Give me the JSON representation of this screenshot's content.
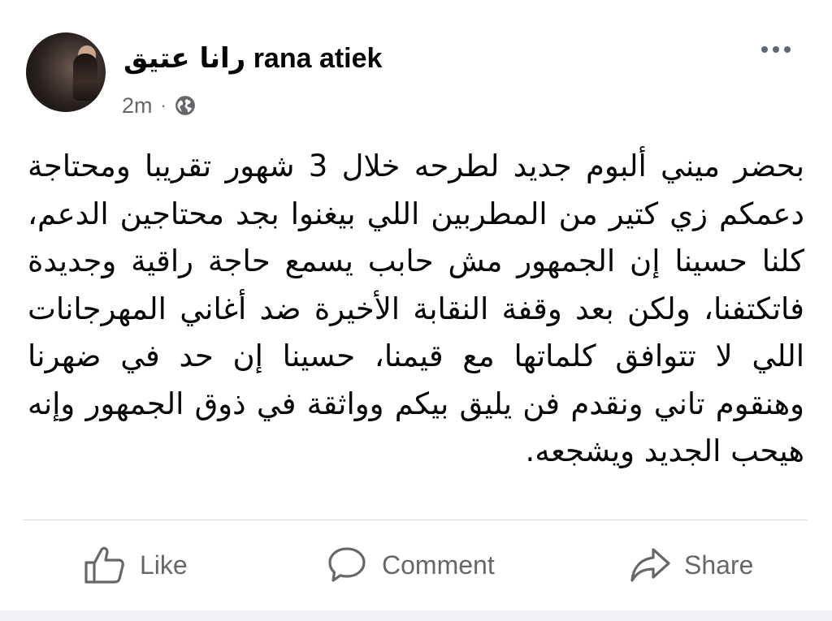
{
  "post": {
    "author_name_ar": "رانا عتيق",
    "author_name_en": "rana atiek",
    "timestamp": "2m",
    "separator": "·",
    "privacy_icon": "globe-icon",
    "more_icon": "more-options-icon",
    "text": "بحضر ميني ألبوم جديد لطرحه خلال 3 شهور تقريبا ومحتاجة دعمكم زي كتير من المطربين اللي بيغنوا بجد محتاجين الدعم، كلنا حسينا إن الجمهور مش حابب يسمع حاجة راقية وجديدة فاتكتفنا، ولكن بعد وقفة النقابة الأخيرة ضد أغاني المهرجانات اللي لا تتوافق كلماتها مع قيمنا، حسينا إن حد في ضهرنا وهنقوم تاني ونقدم فن يليق بيكم وواثقة في ذوق الجمهور وإنه هيحب الجديد ويشجعه."
  },
  "actions": {
    "like_label": "Like",
    "comment_label": "Comment",
    "share_label": "Share"
  },
  "colors": {
    "text_primary": "#050505",
    "text_secondary": "#65676b",
    "divider": "#d6d9dd"
  }
}
